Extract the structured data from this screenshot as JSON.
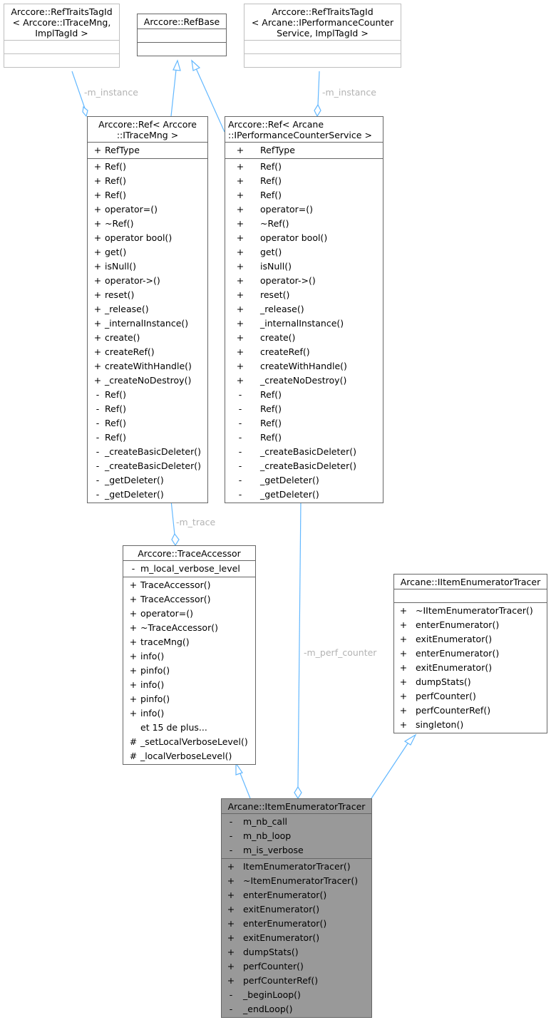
{
  "diagram": {
    "classes": {
      "reftraits_tracemng": {
        "title_lines": [
          "Arccore::RefTraitsTagId",
          "< Arccore::ITraceMng,",
          "ImplTagId >"
        ],
        "attributes": [],
        "methods": []
      },
      "refbase": {
        "title_lines": [
          "Arccore::RefBase"
        ],
        "attributes": [],
        "methods": []
      },
      "reftraits_perfcounter": {
        "title_lines": [
          "Arccore::RefTraitsTagId",
          "< Arcane::IPerformanceCounter",
          "Service, ImplTagId >"
        ],
        "attributes": [],
        "methods": []
      },
      "ref_tracemng": {
        "title_lines": [
          "Arccore::Ref< Arccore",
          "::ITraceMng >"
        ],
        "attributes": [
          {
            "vis": "+",
            "name": "RefType"
          }
        ],
        "methods": [
          {
            "vis": "+",
            "name": "Ref()"
          },
          {
            "vis": "+",
            "name": "Ref()"
          },
          {
            "vis": "+",
            "name": "Ref()"
          },
          {
            "vis": "+",
            "name": "operator=()"
          },
          {
            "vis": "+",
            "name": "~Ref()"
          },
          {
            "vis": "+",
            "name": "operator bool()"
          },
          {
            "vis": "+",
            "name": "get()"
          },
          {
            "vis": "+",
            "name": "isNull()"
          },
          {
            "vis": "+",
            "name": "operator->()"
          },
          {
            "vis": "+",
            "name": "reset()"
          },
          {
            "vis": "+",
            "name": "_release()"
          },
          {
            "vis": "+",
            "name": "_internalInstance()"
          },
          {
            "vis": "+",
            "name": "create()"
          },
          {
            "vis": "+",
            "name": "createRef()"
          },
          {
            "vis": "+",
            "name": "createWithHandle()"
          },
          {
            "vis": "+",
            "name": "_createNoDestroy()"
          },
          {
            "vis": "-",
            "name": "Ref()"
          },
          {
            "vis": "-",
            "name": "Ref()"
          },
          {
            "vis": "-",
            "name": "Ref()"
          },
          {
            "vis": "-",
            "name": "Ref()"
          },
          {
            "vis": "-",
            "name": "_createBasicDeleter()"
          },
          {
            "vis": "-",
            "name": "_createBasicDeleter()"
          },
          {
            "vis": "-",
            "name": "_getDeleter()"
          },
          {
            "vis": "-",
            "name": "_getDeleter()"
          }
        ]
      },
      "ref_perfcounter": {
        "title_lines": [
          "Arccore::Ref< Arcane",
          "::IPerformanceCounterService >"
        ],
        "attributes": [
          {
            "vis": "+",
            "name": "RefType"
          }
        ],
        "methods": [
          {
            "vis": "+",
            "name": "Ref()"
          },
          {
            "vis": "+",
            "name": "Ref()"
          },
          {
            "vis": "+",
            "name": "Ref()"
          },
          {
            "vis": "+",
            "name": "operator=()"
          },
          {
            "vis": "+",
            "name": "~Ref()"
          },
          {
            "vis": "+",
            "name": "operator bool()"
          },
          {
            "vis": "+",
            "name": "get()"
          },
          {
            "vis": "+",
            "name": "isNull()"
          },
          {
            "vis": "+",
            "name": "operator->()"
          },
          {
            "vis": "+",
            "name": "reset()"
          },
          {
            "vis": "+",
            "name": "_release()"
          },
          {
            "vis": "+",
            "name": "_internalInstance()"
          },
          {
            "vis": "+",
            "name": "create()"
          },
          {
            "vis": "+",
            "name": "createRef()"
          },
          {
            "vis": "+",
            "name": "createWithHandle()"
          },
          {
            "vis": "+",
            "name": "_createNoDestroy()"
          },
          {
            "vis": "-",
            "name": "Ref()"
          },
          {
            "vis": "-",
            "name": "Ref()"
          },
          {
            "vis": "-",
            "name": "Ref()"
          },
          {
            "vis": "-",
            "name": "Ref()"
          },
          {
            "vis": "-",
            "name": "_createBasicDeleter()"
          },
          {
            "vis": "-",
            "name": "_createBasicDeleter()"
          },
          {
            "vis": "-",
            "name": "_getDeleter()"
          },
          {
            "vis": "-",
            "name": "_getDeleter()"
          }
        ]
      },
      "trace_accessor": {
        "title_lines": [
          "Arccore::TraceAccessor"
        ],
        "attributes": [
          {
            "vis": "-",
            "name": "m_local_verbose_level"
          }
        ],
        "methods": [
          {
            "vis": "+",
            "name": "TraceAccessor()"
          },
          {
            "vis": "+",
            "name": "TraceAccessor()"
          },
          {
            "vis": "+",
            "name": "operator=()"
          },
          {
            "vis": "+",
            "name": "~TraceAccessor()"
          },
          {
            "vis": "+",
            "name": "traceMng()"
          },
          {
            "vis": "+",
            "name": "info()"
          },
          {
            "vis": "+",
            "name": "pinfo()"
          },
          {
            "vis": "+",
            "name": "info()"
          },
          {
            "vis": "+",
            "name": "pinfo()"
          },
          {
            "vis": "+",
            "name": "info()"
          },
          {
            "vis": "",
            "name": "et 15 de plus..."
          },
          {
            "vis": "#",
            "name": "_setLocalVerboseLevel()"
          },
          {
            "vis": "#",
            "name": "_localVerboseLevel()"
          }
        ]
      },
      "iitem_enumerator_tracer": {
        "title_lines": [
          "Arcane::IItemEnumeratorTracer"
        ],
        "attributes": [],
        "methods": [
          {
            "vis": "+",
            "name": "~IItemEnumeratorTracer()"
          },
          {
            "vis": "+",
            "name": "enterEnumerator()"
          },
          {
            "vis": "+",
            "name": "exitEnumerator()"
          },
          {
            "vis": "+",
            "name": "enterEnumerator()"
          },
          {
            "vis": "+",
            "name": "exitEnumerator()"
          },
          {
            "vis": "+",
            "name": "dumpStats()"
          },
          {
            "vis": "+",
            "name": "perfCounter()"
          },
          {
            "vis": "+",
            "name": "perfCounterRef()"
          },
          {
            "vis": "+",
            "name": "singleton()"
          }
        ]
      },
      "item_enumerator_tracer": {
        "title_lines": [
          "Arcane::ItemEnumeratorTracer"
        ],
        "attributes": [
          {
            "vis": "-",
            "name": "m_nb_call"
          },
          {
            "vis": "-",
            "name": "m_nb_loop"
          },
          {
            "vis": "-",
            "name": "m_is_verbose"
          }
        ],
        "methods": [
          {
            "vis": "+",
            "name": "ItemEnumeratorTracer()"
          },
          {
            "vis": "+",
            "name": "~ItemEnumeratorTracer()"
          },
          {
            "vis": "+",
            "name": "enterEnumerator()"
          },
          {
            "vis": "+",
            "name": "exitEnumerator()"
          },
          {
            "vis": "+",
            "name": "enterEnumerator()"
          },
          {
            "vis": "+",
            "name": "exitEnumerator()"
          },
          {
            "vis": "+",
            "name": "dumpStats()"
          },
          {
            "vis": "+",
            "name": "perfCounter()"
          },
          {
            "vis": "+",
            "name": "perfCounterRef()"
          },
          {
            "vis": "-",
            "name": "_beginLoop()"
          },
          {
            "vis": "-",
            "name": "_endLoop()"
          }
        ]
      }
    },
    "edge_labels": {
      "m_instance_left": "-m_instance",
      "m_instance_right": "-m_instance",
      "m_trace": "-m_trace",
      "m_perf_counter": "-m_perf_counter"
    },
    "colors": {
      "edge": "#63b8ff",
      "box_border": "#666666",
      "box_border_light": "#bfbfbf",
      "focus_fill": "#999999",
      "edge_label": "#b3b3b3"
    }
  }
}
